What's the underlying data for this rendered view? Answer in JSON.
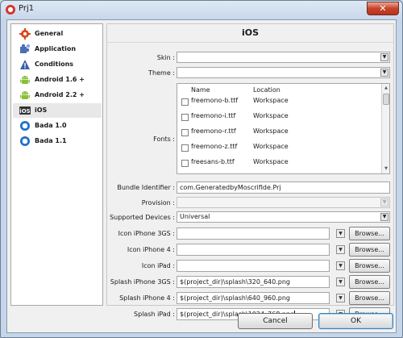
{
  "window": {
    "title": "Prj1",
    "close_glyph": "✕",
    "app_icon": "moscrif-logo-icon"
  },
  "sidebar": {
    "items": [
      {
        "label": "General",
        "icon": "gear-icon",
        "color": "#d84a1b"
      },
      {
        "label": "Application",
        "icon": "puzzle-icon",
        "color": "#4b6fb5"
      },
      {
        "label": "Conditions",
        "icon": "warning-icon",
        "color": "#3a5fa8"
      },
      {
        "label": "Android 1.6 +",
        "icon": "android-icon",
        "color": "#8bbf3a"
      },
      {
        "label": "Android 2.2 +",
        "icon": "android-icon",
        "color": "#8bbf3a"
      },
      {
        "label": "iOS",
        "icon": "ios-icon",
        "color": "#333333",
        "selected": true
      },
      {
        "label": "Bada 1.0",
        "icon": "bada-icon",
        "color": "#1f6fc9"
      },
      {
        "label": "Bada 1.1",
        "icon": "bada-icon",
        "color": "#1f6fc9"
      }
    ],
    "ios_icon_text": "iOS"
  },
  "main": {
    "title": "iOS",
    "skin": {
      "label": "Skin :",
      "value": ""
    },
    "theme": {
      "label": "Theme :",
      "value": ""
    },
    "fonts": {
      "label": "Fonts :",
      "headers": [
        "Name",
        "Location"
      ],
      "rows": [
        {
          "name": "freemono-b.ttf",
          "location": "Workspace"
        },
        {
          "name": "freemono-i.ttf",
          "location": "Workspace"
        },
        {
          "name": "freemono-r.ttf",
          "location": "Workspace"
        },
        {
          "name": "freemono-z.ttf",
          "location": "Workspace"
        },
        {
          "name": "freesans-b.ttf",
          "location": "Workspace"
        }
      ]
    },
    "bundle_identifier": {
      "label": "Bundle Identifier :",
      "value": "com.GeneratedbyMoscrifIde.Prj"
    },
    "provision": {
      "label": "Provision :",
      "value": ""
    },
    "supported_devices": {
      "label": "Supported Devices :",
      "value": "Universal"
    },
    "file_rows": [
      {
        "label": "Icon iPhone 3GS :",
        "value": ""
      },
      {
        "label": "Icon iPhone 4 :",
        "value": ""
      },
      {
        "label": "Icon iPad :",
        "value": ""
      },
      {
        "label": "Splash iPhone 3GS :",
        "value": "$(project_dir)\\splash\\320_640.png"
      },
      {
        "label": "Splash iPhone 4 :",
        "value": "$(project_dir)\\splash\\640_960.png"
      },
      {
        "label": "Splash iPad :",
        "value": "$(project_dir)\\splash\\1024_768.png"
      }
    ],
    "browse_label": "Browse..."
  },
  "footer": {
    "cancel_label": "Cancel",
    "ok_label": "OK"
  }
}
